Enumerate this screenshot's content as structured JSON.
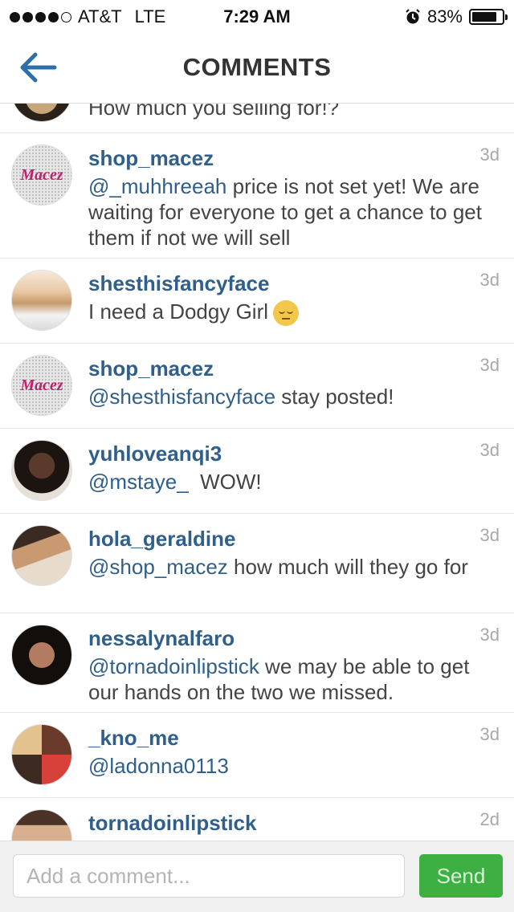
{
  "status_bar": {
    "carrier": "AT&T",
    "network": "LTE",
    "time": "7:29 AM",
    "battery": "83%",
    "battery_level": 0.83,
    "signal_bars_filled": 4,
    "signal_bars_total": 5
  },
  "header": {
    "title": "COMMENTS",
    "accent_color": "#2f6fa8"
  },
  "comments": [
    {
      "user": "",
      "time": "",
      "text": "How much you selling for!?",
      "partial": true
    },
    {
      "user": "shop_macez",
      "time": "3d",
      "mention": "@_muhhreeah",
      "text": " price is not set yet! We are waiting for everyone to get a chance to get them if not we will sell",
      "avatar_text": "Macez"
    },
    {
      "user": "shesthisfancyface",
      "time": "3d",
      "mention": "",
      "text": "I need a Dodgy Girl",
      "emoji": "pensive-face"
    },
    {
      "user": "shop_macez",
      "time": "3d",
      "mention": "@shesthisfancyface",
      "text": " stay posted!",
      "avatar_text": "Macez"
    },
    {
      "user": "yuhloveanqi3",
      "time": "3d",
      "mention": "@mstaye_",
      "text": "  WOW!"
    },
    {
      "user": "hola_geraldine",
      "time": "3d",
      "mention": "@shop_macez",
      "text": " how much will they go for"
    },
    {
      "user": "nessalynalfaro",
      "time": "3d",
      "mention": "@tornadoinlipstick",
      "text": " we may be able to get our hands on the two we missed."
    },
    {
      "user": "_kno_me",
      "time": "3d",
      "mention": "@ladonna0113",
      "text": ""
    },
    {
      "user": "tornadoinlipstick",
      "time": "2d",
      "mention": "",
      "text": ""
    }
  ],
  "composer": {
    "placeholder": "Add a comment...",
    "send_label": "Send",
    "send_color": "#3eb043"
  }
}
